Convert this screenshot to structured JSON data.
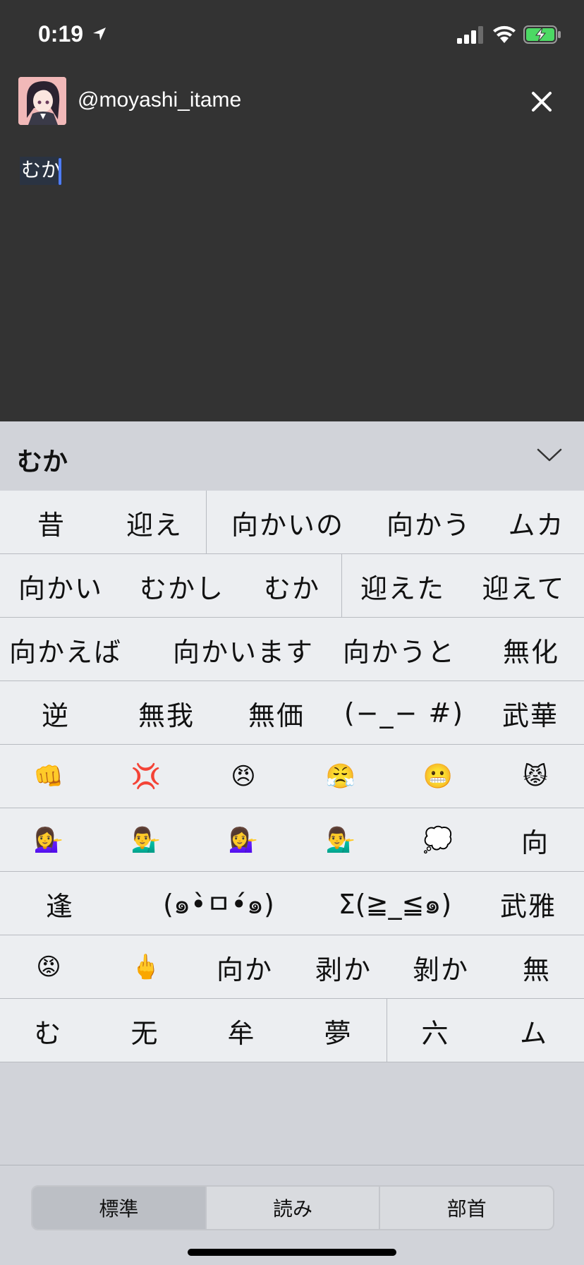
{
  "status_bar": {
    "time": "0:19",
    "location_icon": "location-arrow-icon",
    "signal_icon": "cellular-signal-icon",
    "wifi_icon": "wifi-icon",
    "battery_icon": "battery-charging-icon",
    "battery_color": "#4cd964"
  },
  "compose": {
    "username": "@moyashi_itame",
    "close_icon": "close-icon",
    "text": "むか",
    "cursor_color": "#4f7cf4"
  },
  "candidates": {
    "reading": "むか",
    "collapse_icon": "chevron-down-icon",
    "rows": [
      [
        "昔",
        "迎え",
        "向かいの",
        "向かう",
        "ムカ"
      ],
      [
        "向かい",
        "むかし",
        "むか",
        "迎えた",
        "迎えて"
      ],
      [
        "向かえば",
        "向かいます",
        "向かうと",
        "無化"
      ],
      [
        "逆",
        "無我",
        "無価",
        "(−_− #)",
        "武華"
      ],
      [
        "👊",
        "💢",
        "😠",
        "😤",
        "😬",
        "😾"
      ],
      [
        "💁‍♀️",
        "💁‍♂️",
        "💁‍♀️",
        "💁‍♂️",
        "💭",
        "向"
      ],
      [
        "逢",
        "(๑•̀ㅁ•́๑)",
        "Σ(≧_≦๑)",
        "武雅"
      ],
      [
        "😡",
        "🖕",
        "向か",
        "剥か",
        "剝か",
        "無"
      ],
      [
        "む",
        "无",
        "牟",
        "夢",
        "六",
        "ム"
      ]
    ]
  },
  "segments": {
    "items": [
      "標準",
      "読み",
      "部首"
    ],
    "selected": "標準"
  }
}
